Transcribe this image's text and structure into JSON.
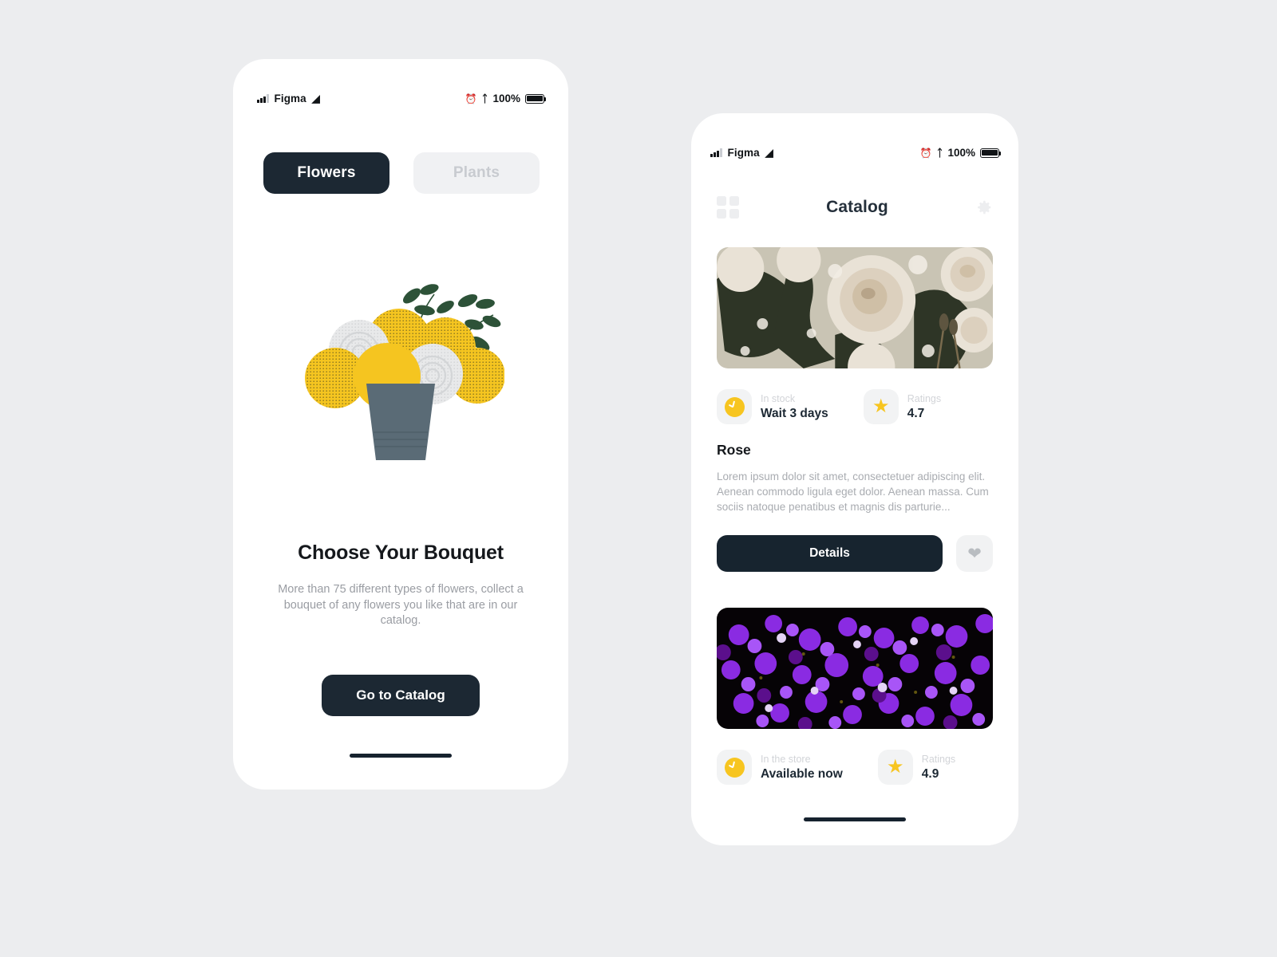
{
  "canvas": {
    "background": "#ECEDEF"
  },
  "palette": {
    "dark": "#1C2833",
    "accent_yellow": "#F7C520",
    "muted_text": "#A9ACB1",
    "chip_bg": "#F2F3F4"
  },
  "onboarding_screen": {
    "status_bar": {
      "carrier": "Figma",
      "signal_icon": "signal-bars-icon",
      "wifi_icon": "wifi-icon",
      "alarm_icon": "alarm-clock-icon",
      "bluetooth_icon": "bluetooth-icon",
      "battery_percent": "100%",
      "battery_icon": "battery-full-icon"
    },
    "tabs": [
      {
        "label": "Flowers",
        "active": true
      },
      {
        "label": "Plants",
        "active": false
      }
    ],
    "illustration": {
      "name": "bouquet-illustration",
      "vase_color": "#5A6B76",
      "flower_yellow": "#F5C520",
      "flower_white": "#E8E9EA",
      "leaf_green": "#2D5238"
    },
    "title": "Choose Your Bouquet",
    "subtitle": "More than 75 different types of flowers, collect a bouquet of any flowers you like that are in our catalog.",
    "cta_label": "Go to Catalog",
    "home_indicator": "home-indicator"
  },
  "catalog_screen": {
    "status_bar": {
      "carrier": "Figma",
      "signal_icon": "signal-bars-icon",
      "wifi_icon": "wifi-icon",
      "alarm_icon": "alarm-clock-icon",
      "bluetooth_icon": "bluetooth-icon",
      "battery_percent": "100%",
      "battery_icon": "battery-full-icon"
    },
    "header": {
      "grid_icon": "grid-view-icon",
      "title": "Catalog",
      "settings_icon": "gear-icon"
    },
    "products": [
      {
        "photo_name": "white-roses-photo",
        "stock_label": "In stock",
        "stock_value": "Wait 3 days",
        "rating_label": "Ratings",
        "rating_value": "4.7",
        "name": "Rose",
        "description": "Lorem ipsum dolor sit amet, consectetuer adipiscing elit. Aenean commodo ligula eget dolor. Aenean massa. Cum sociis natoque penatibus et magnis dis parturie...",
        "details_label": "Details",
        "favorite_icon": "heart-icon"
      },
      {
        "photo_name": "purple-flowers-photo",
        "stock_label": "In the store",
        "stock_value": "Available now",
        "rating_label": "Ratings",
        "rating_value": "4.9"
      }
    ],
    "home_indicator": "home-indicator"
  }
}
